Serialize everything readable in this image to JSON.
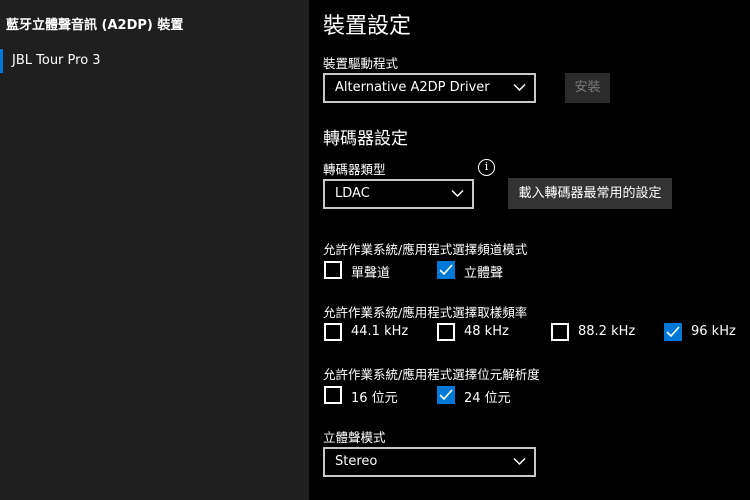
{
  "sidebar": {
    "title": "藍牙立體聲音訊 (A2DP) 裝置",
    "items": [
      {
        "label": "JBL Tour Pro 3",
        "selected": true
      }
    ]
  },
  "main": {
    "page_title": "裝置設定",
    "driver": {
      "label": "裝置驅動程式",
      "selected": "Alternative A2DP Driver",
      "install_label": "安裝"
    },
    "codec_section": {
      "title": "轉碼器設定",
      "codec_label": "轉碼器類型",
      "codec_selected": "LDAC",
      "info_icon": "i",
      "load_button": "載入轉碼器最常用的設定"
    },
    "channel_mode": {
      "label": "允許作業系統/應用程式選擇頻道模式",
      "options": [
        {
          "label": "單聲道",
          "checked": false
        },
        {
          "label": "立體聲",
          "checked": true
        }
      ]
    },
    "sample_rate": {
      "label": "允許作業系統/應用程式選擇取樣頻率",
      "options": [
        {
          "label": "44.1 kHz",
          "checked": false
        },
        {
          "label": "48 kHz",
          "checked": false
        },
        {
          "label": "88.2 kHz",
          "checked": false
        },
        {
          "label": "96 kHz",
          "checked": true
        }
      ]
    },
    "bit_depth": {
      "label": "允許作業系統/應用程式選擇位元解析度",
      "options": [
        {
          "label": "16 位元",
          "checked": false
        },
        {
          "label": "24 位元",
          "checked": true
        }
      ]
    },
    "stereo_mode": {
      "label": "立體聲模式",
      "selected": "Stereo"
    }
  },
  "colors": {
    "accent": "#0078d7",
    "sidebar_bg": "#1f1f1f",
    "main_bg": "#000000"
  }
}
